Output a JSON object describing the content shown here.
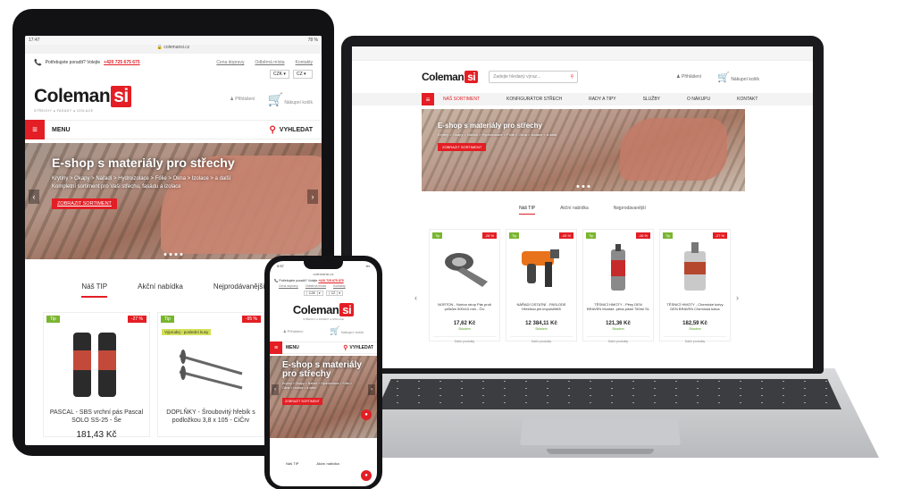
{
  "brand": {
    "name_main": "Coleman",
    "name_accent": "si",
    "tagline": "STŘECHY ● FASÁDY ● IZOLACE",
    "accent_color": "#e31e24",
    "tip_color": "#7ab52f"
  },
  "laptop": {
    "search_placeholder": "Zadejte hledaný výraz...",
    "login_label": "Přihlášení",
    "cart_label": "Nákupní košík",
    "nav": [
      "NÁŠ SORTIMENT",
      "KONFIGURÁTOR STŘECH",
      "RADY A TIPY",
      "SLUŽBY",
      "O NÁKUPU",
      "KONTAKT"
    ],
    "hero": {
      "title": "E-shop s materiály pro střechy",
      "crumbs": "Krytiny > Okapy > Nářadí > Hydroizolace > Fólie > Okna > Izolace > a další",
      "button": "ZOBRAZIT SORTIMENT"
    },
    "tabs": [
      "Náš TIP",
      "Akční nabídka",
      "Nejprodávanější"
    ],
    "products": [
      {
        "badge": "Tip",
        "pct": "-28 %",
        "name": "NORTON - Norton strop Pás proti průkům 500x10 mm - Čiv",
        "price": "17,62 Kč",
        "stock": "Skladem",
        "more": "Další produkty",
        "img": "tape-icon"
      },
      {
        "badge": "Tip",
        "pct": "-43 %",
        "name": "NÁŘADÍ OSTATNÍ - PASLODE Hřebíkov.pin.impulsIM65",
        "price": "12 384,11 Kč",
        "stock": "Skladem",
        "more": "Další produkty",
        "img": "nail-gun-icon"
      },
      {
        "badge": "Tip",
        "pct": "-16 %",
        "name": "TĚSNICÍ HMOTY - Pěny DEN BRAVEN Montáž. pěna pistol 750ml SL",
        "price": "121,36 Kč",
        "stock": "Skladem",
        "more": "Další produkty",
        "img": "foam-can-icon"
      },
      {
        "badge": "Tip",
        "pct": "-27 %",
        "name": "TĚSNICÍ HMOTY - Chemické kotvy DEN BRAVEN Chemická kotva",
        "price": "182,59 Kč",
        "stock": "Skladem",
        "more": "Další produkty",
        "img": "anchor-tube-icon"
      }
    ]
  },
  "tablet": {
    "status_time": "17:47",
    "status_batt": "78 %",
    "url": "colemansi.cz",
    "help_text": "Potřebujete poradit? Volejte",
    "phone_number": "+420 725 675 675",
    "links": [
      "Cena dopravy",
      "Odběrná místa",
      "Kontakty"
    ],
    "currency": "CZK",
    "language": "CZ",
    "login_label": "Přihlášení",
    "cart_label": "Nákupní košík",
    "menu_label": "MENU",
    "search_label": "VYHLEDAT",
    "hero": {
      "title": "E-shop s materiály pro střechy",
      "crumbs": "Krytiny > Okapy > Nářadí > Hydroizolace > Fólie > Okna > Izolace > a další",
      "sub": "Kompletní sortiment pro Vaši střechu, fasádu a izolace",
      "button": "ZOBRAZIT SORTIMENT"
    },
    "tabs": [
      "Náš TIP",
      "Akční nabídka",
      "Nejprodávanější"
    ],
    "products": [
      {
        "badge": "Tip",
        "pct": "-27 %",
        "name": "PASCAL - SBS vrchní pás Pascal SOLO SS-25 - Še",
        "price": "181,43 Kč",
        "img": "roll-icon"
      },
      {
        "badge": "Tip",
        "pct": "-95 %",
        "flag": "Výprodej - poslední kusy",
        "name": "DOPLŇKY - Šroubovitý hřebík s podložkou 3,8 x 105 - CiČrv",
        "price": "",
        "img": "screw-icon"
      }
    ]
  },
  "phone": {
    "status_time": "9:57",
    "url": "colemansi.cz",
    "help_text": "Potřebujete poradit? Volejte",
    "phone_number": "+420 725 675 675",
    "links": [
      "Cena dopravy",
      "Odběrná místa",
      "Kontakty"
    ],
    "currency": "CZK",
    "language": "CZ",
    "login_label": "Přihlášení",
    "cart_label": "Nákupní košík",
    "menu_label": "MENU",
    "search_label": "VYHLEDAT",
    "hero": {
      "title": "E-shop s materiály pro střechy",
      "crumbs": "Krytiny > Okapy > Nářadí > Hydroizolace > Fólie > Okna > Izolace > a další",
      "button": "ZOBRAZIT SORTIMENT"
    },
    "tabs": [
      "Náš TIP",
      "Akční nabídka"
    ]
  }
}
